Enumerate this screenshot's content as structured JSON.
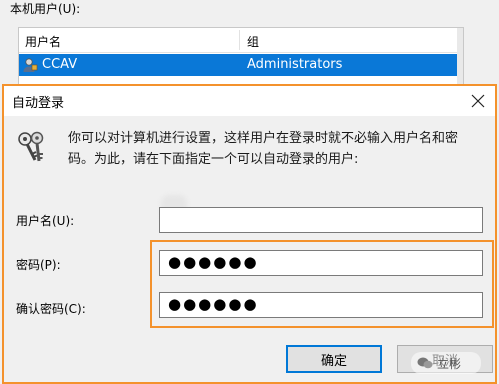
{
  "background_dialog": {
    "users_label": "本机用户(U):",
    "columns": [
      "用户名",
      "组"
    ],
    "selected_user": {
      "name": "CCAV",
      "group": "Administrators"
    }
  },
  "dialog": {
    "title": "自动登录",
    "description_line1": "你可以对计算机进行设置，这样用户在登录时就不必输入用户名和密",
    "description_line2": "码。为此，请在下面指定一个可以自动登录的用户:",
    "username_label": "用户名(U):",
    "username_value": "",
    "password_label": "密码(P):",
    "password_value": "●●●●●●",
    "confirm_label": "确认密码(C):",
    "confirm_value": "●●●●●●",
    "ok_label": "确定",
    "cancel_label": "取消"
  },
  "watermark": {
    "text": "立彬"
  },
  "colors": {
    "accent": "#0a78d7",
    "highlight_border": "#f4922c"
  }
}
